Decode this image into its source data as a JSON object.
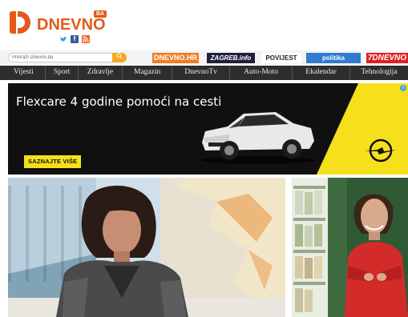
{
  "header": {
    "logo_text": "DNEVNO",
    "logo_badge": "BA",
    "social_icons": [
      "twitter-icon",
      "facebook-icon",
      "rss-icon"
    ]
  },
  "search": {
    "placeholder": "Pretraži Dnevno.ba",
    "button_icon": "search-icon"
  },
  "partners": [
    {
      "label": "DNEVNO.HR"
    },
    {
      "label": "ZAGREB.info"
    },
    {
      "label": "POVIJEST"
    },
    {
      "label": "politika"
    },
    {
      "label": "7DNEVNO"
    }
  ],
  "nav": {
    "items": [
      {
        "label": "Vijesti"
      },
      {
        "label": "Sport"
      },
      {
        "label": "Zdravlje"
      },
      {
        "label": "Magazin"
      },
      {
        "label": "DnevnoTv"
      },
      {
        "label": "Auto-Moto"
      },
      {
        "label": "Ekalendar"
      },
      {
        "label": "Tehnologija"
      }
    ]
  },
  "ad": {
    "headline": "Flexcare 4 godine pomoći na cesti",
    "cta": "SAZNAJTE VIŠE",
    "info_icon": "info-icon",
    "brand_icon": "opel-logo-icon",
    "colors": {
      "background": "#101010",
      "accent": "#f6e01b"
    }
  },
  "colors": {
    "brand": "#e35a1b",
    "nav_bg": "#2e2e2e",
    "search_button": "#f5a623"
  }
}
